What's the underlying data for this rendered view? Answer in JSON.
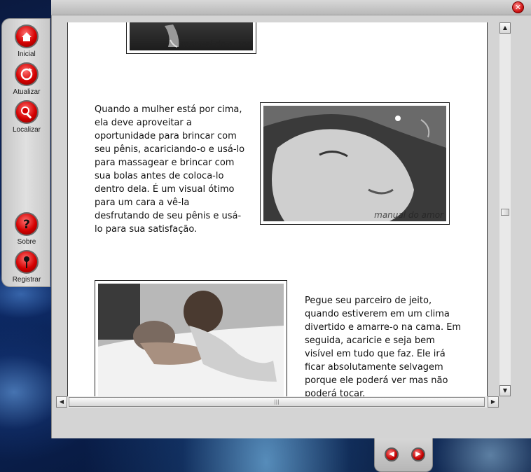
{
  "colors": {
    "accent_red": "#d40000",
    "panel_gray": "#d4d4d4",
    "wallpaper_blue": "#0c2a66"
  },
  "window": {
    "close_icon": "close-icon"
  },
  "sidebar": {
    "items": [
      {
        "label": "Inicial",
        "icon": "home-icon"
      },
      {
        "label": "Atualizar",
        "icon": "refresh-icon"
      },
      {
        "label": "Localizar",
        "icon": "search-icon"
      },
      {
        "label": "Sobre",
        "icon": "help-icon"
      },
      {
        "label": "Registrar",
        "icon": "pin-icon"
      }
    ]
  },
  "content": {
    "watermark": "manual do amor",
    "paragraph1": "Quando a mulher está por cima, ela deve aproveitar a oportunidade para brincar com seu pênis, acariciando-o e usá-lo para massagear e brincar com sua bolas antes de coloca-lo dentro dela. É um visual ótimo para um cara a vê-la desfrutando de seu pênis e usá-lo para sua satisfação.",
    "paragraph2": "Pegue seu parceiro de jeito, quando estiverem em um clima divertido e amarre-o na cama. Em seguida, acaricie e seja bem visível em tudo que faz. Ele irá ficar absolutamente selvagem porque ele poderá ver mas não poderá tocar."
  },
  "navigation": {
    "prev_icon": "arrow-left-icon",
    "next_icon": "arrow-right-icon"
  }
}
